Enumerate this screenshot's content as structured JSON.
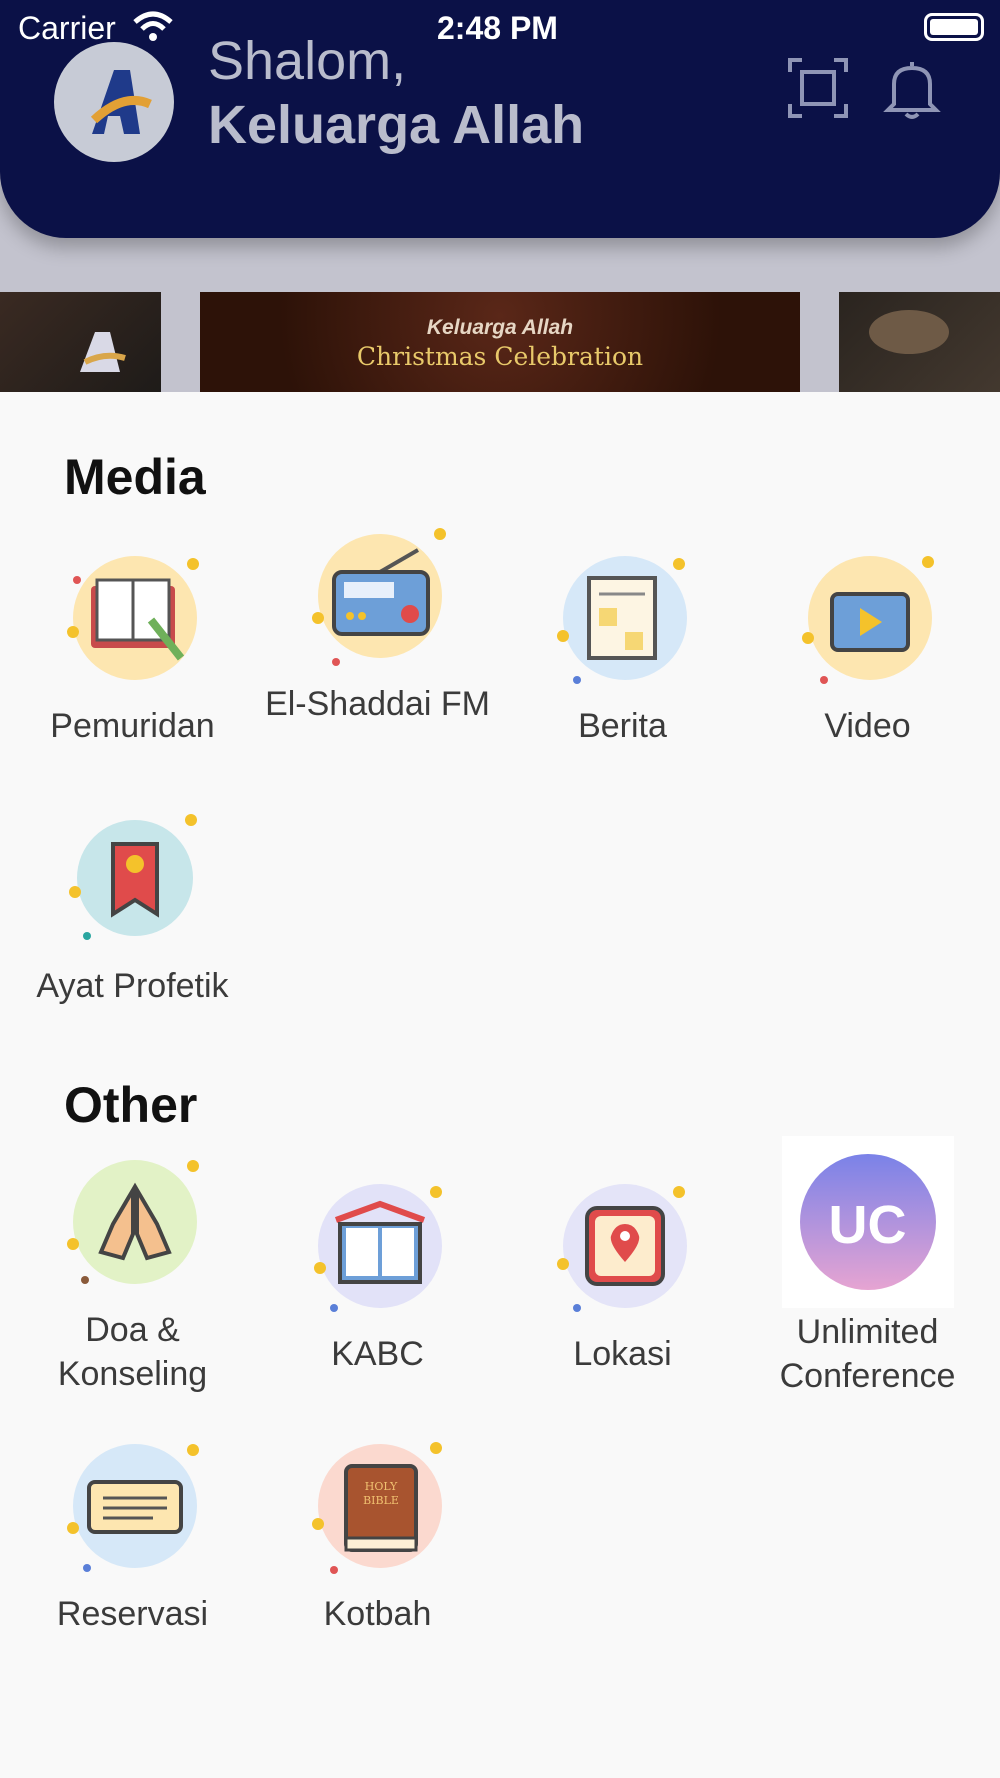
{
  "status_bar": {
    "carrier": "Carrier",
    "time": "2:48 PM"
  },
  "header": {
    "greeting": "Shalom,",
    "name": "Keluarga Allah",
    "logo_letter": "A"
  },
  "banner": {
    "line1": "Keluarga Allah",
    "line2": "Christmas Celebration"
  },
  "sections": {
    "media": {
      "title": "Media",
      "items": [
        "Pemuridan",
        "El-Shaddai FM",
        "Berita",
        "Video",
        "Ayat Profetik"
      ]
    },
    "other": {
      "title": "Other",
      "items": [
        "Doa & Konseling",
        "KABC",
        "Lokasi",
        "Unlimited Conference",
        "Reservasi",
        "Kotbah"
      ],
      "uc_badge": "UC"
    }
  },
  "colors": {
    "header": "#0b1147",
    "sheet": "#f9f9f9"
  }
}
